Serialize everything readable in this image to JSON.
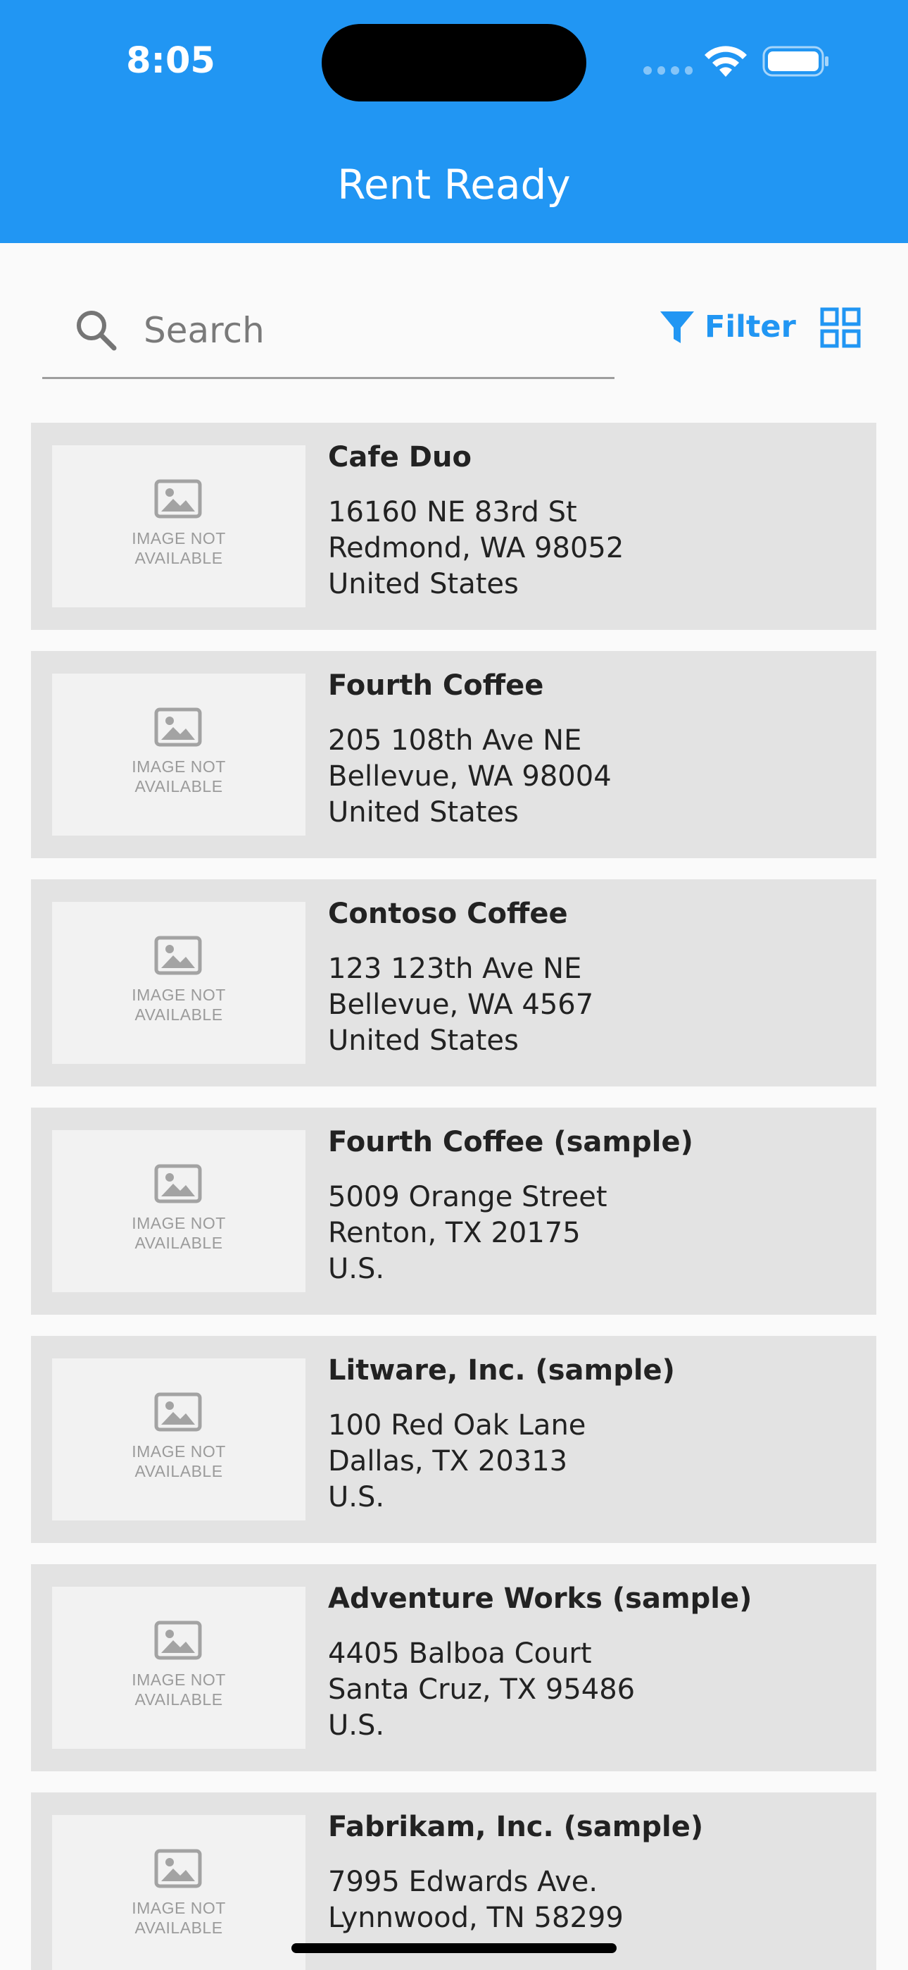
{
  "status_bar": {
    "time": "8:05"
  },
  "header": {
    "title": "Rent Ready",
    "background_color": "#2196f3"
  },
  "search": {
    "placeholder": "Search",
    "value": ""
  },
  "toolbar": {
    "filter_label": "Filter",
    "accent_color": "#2196f3",
    "grid_icon": "grid-view-icon"
  },
  "properties": [
    {
      "name": "Cafe Duo",
      "address_line1": "16160 NE 83rd St",
      "address_line2": "Redmond, WA 98052",
      "address_line3": "United States",
      "image_text_1": "IMAGE NOT",
      "image_text_2": "AVAILABLE"
    },
    {
      "name": "Fourth Coffee",
      "address_line1": "205 108th Ave NE",
      "address_line2": "Bellevue, WA 98004",
      "address_line3": "United States",
      "image_text_1": "IMAGE NOT",
      "image_text_2": "AVAILABLE"
    },
    {
      "name": "Contoso Coffee",
      "address_line1": "123 123th Ave NE",
      "address_line2": "Bellevue, WA 4567",
      "address_line3": "United States",
      "image_text_1": "IMAGE NOT",
      "image_text_2": "AVAILABLE"
    },
    {
      "name": "Fourth Coffee (sample)",
      "address_line1": "5009 Orange Street",
      "address_line2": "Renton, TX 20175",
      "address_line3": "U.S.",
      "image_text_1": "IMAGE NOT",
      "image_text_2": "AVAILABLE"
    },
    {
      "name": "Litware, Inc. (sample)",
      "address_line1": "100 Red Oak Lane",
      "address_line2": "Dallas, TX 20313",
      "address_line3": "U.S.",
      "image_text_1": "IMAGE NOT",
      "image_text_2": "AVAILABLE"
    },
    {
      "name": "Adventure Works (sample)",
      "address_line1": "4405 Balboa Court",
      "address_line2": "Santa Cruz, TX 95486",
      "address_line3": "U.S.",
      "image_text_1": "IMAGE NOT",
      "image_text_2": "AVAILABLE"
    },
    {
      "name": "Fabrikam, Inc. (sample)",
      "address_line1": "7995 Edwards Ave.",
      "address_line2": "Lynnwood, TN 58299",
      "address_line3": "",
      "image_text_1": "IMAGE NOT",
      "image_text_2": "AVAILABLE"
    }
  ]
}
